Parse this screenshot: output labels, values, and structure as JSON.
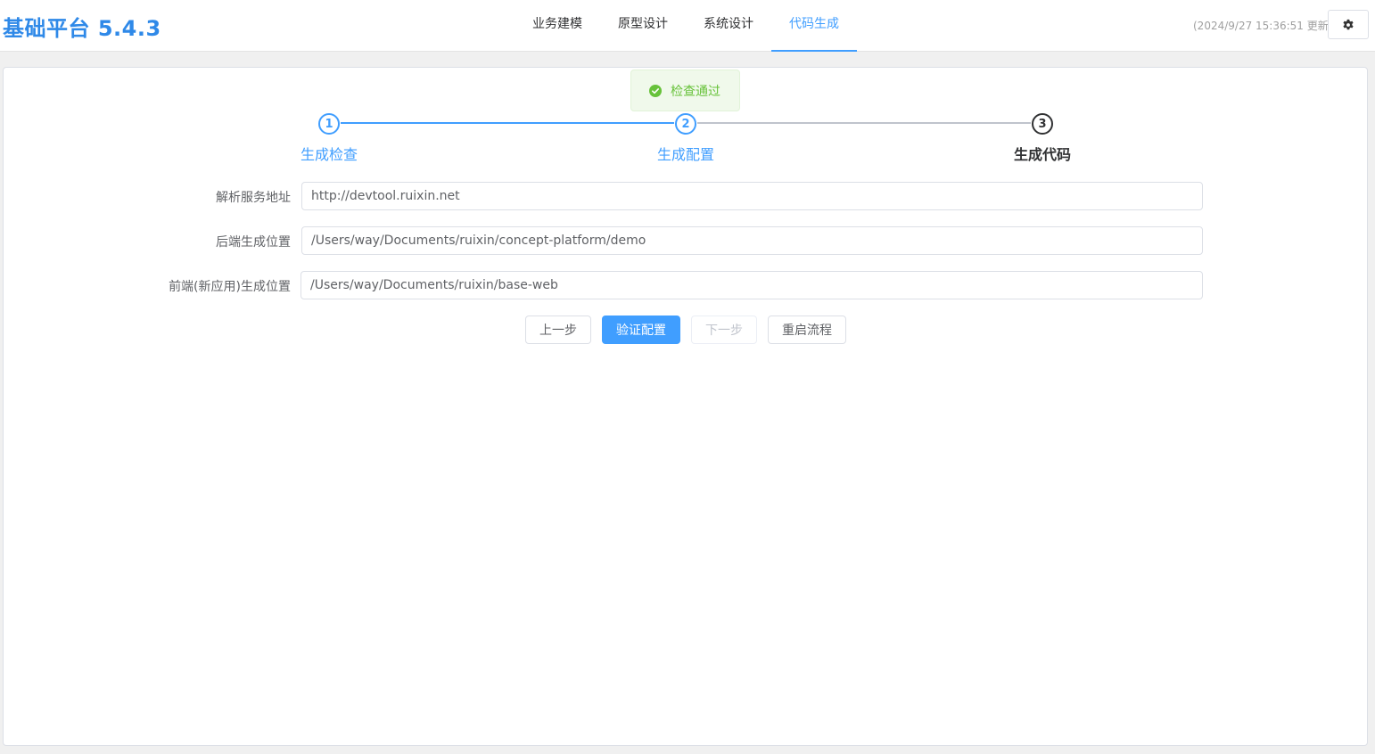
{
  "app": {
    "title": "基础平台 5.4.3"
  },
  "nav": {
    "tabs": [
      {
        "label": "业务建模",
        "active": false
      },
      {
        "label": "原型设计",
        "active": false
      },
      {
        "label": "系统设计",
        "active": false
      },
      {
        "label": "代码生成",
        "active": true
      }
    ]
  },
  "header": {
    "update_time": "(2024/9/27 15:36:51 更新)",
    "settings_icon": "gear-icon"
  },
  "toast": {
    "message": "检查通过",
    "icon": "check-circle-icon",
    "color": "#67c23a"
  },
  "steps": [
    {
      "number": "1",
      "title": "生成检查",
      "status": "finished"
    },
    {
      "number": "2",
      "title": "生成配置",
      "status": "finished"
    },
    {
      "number": "3",
      "title": "生成代码",
      "status": "process"
    }
  ],
  "form": {
    "fields": [
      {
        "label": "解析服务地址",
        "value": "http://devtool.ruixin.net"
      },
      {
        "label": "后端生成位置",
        "value": "/Users/way/Documents/ruixin/concept-platform/demo"
      },
      {
        "label": "前端(新应用)生成位置",
        "value": "/Users/way/Documents/ruixin/base-web"
      }
    ]
  },
  "buttons": {
    "prev": "上一步",
    "validate": "验证配置",
    "next": "下一步",
    "restart": "重启流程"
  },
  "colors": {
    "accent": "#409eff",
    "title": "#2f89e8",
    "success": "#67c23a"
  }
}
